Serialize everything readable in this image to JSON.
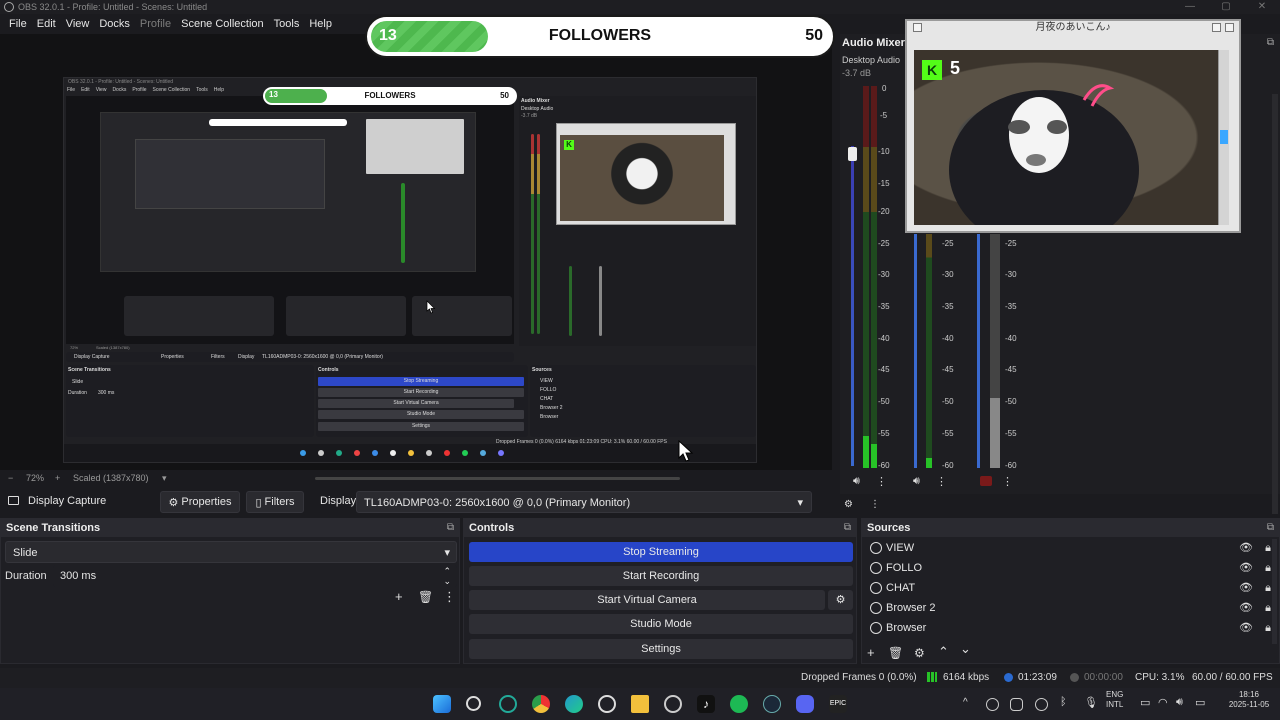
{
  "window": {
    "title": "OBS 32.0.1 - Profile: Untitled - Scenes: Untitled",
    "controls": [
      "—",
      "▢",
      "✕"
    ]
  },
  "menu": [
    "File",
    "Edit",
    "View",
    "Docks",
    "Profile",
    "Scene Collection",
    "Tools",
    "Help"
  ],
  "overlay": {
    "followers_current": "13",
    "followers_label": "FOLLOWERS",
    "followers_goal": "50",
    "followers_progress": 0.26,
    "cam_window_title": "月夜のあいこん♪",
    "kick_count": "5"
  },
  "nested": {
    "title": "OBS 32.0.1 - Profile: Untitled - Scenes: Untitled",
    "menu": [
      "File",
      "Edit",
      "View",
      "Docks",
      "Profile",
      "Scene Collection",
      "Tools",
      "Help"
    ],
    "followers_current": "13",
    "followers_label": "FOLLOWERS",
    "followers_goal": "50",
    "zoom": "72%",
    "scaled": "Scaled (1387x780)",
    "source_name": "Display Capture",
    "properties": "Properties",
    "filters": "Filters",
    "display_label": "Display",
    "display_value": "TL160ADMP03-0: 2560x1600 @ 0,0 (Primary Monitor)",
    "scene_transitions": "Scene Transitions",
    "transition": "Slide",
    "duration_label": "Duration",
    "duration_value": "300 ms",
    "controls": "Controls",
    "btn_stop": "Stop Streaming",
    "btn_rec": "Start Recording",
    "btn_vcam": "Start Virtual Camera",
    "btn_studio": "Studio Mode",
    "btn_settings": "Settings",
    "sources": "Sources",
    "source_list": [
      "VIEW",
      "FOLLO",
      "CHAT",
      "Browser 2",
      "Browser"
    ],
    "status": "Dropped Frames 0 (0.0%)   6164 kbps   01:23:09   CPU: 3.1%  60.00 / 60.00 FPS",
    "mixer_title": "Audio Mixer",
    "mixer_sub": "Desktop Audio",
    "mixer_db": "-3.7 dB"
  },
  "preview_bar": {
    "zoom_minus": "−",
    "zoom": "72%",
    "zoom_plus": "+",
    "scaled": "Scaled (1387x780)"
  },
  "source_toolbar": {
    "name": "Display Capture",
    "properties": "Properties",
    "filters": "Filters",
    "display_label": "Display",
    "display_value": "TL160ADMP03-0: 2560x1600 @ 0,0 (Primary Monitor)"
  },
  "mixer": {
    "title": "Audio Mixer",
    "channel": "Desktop Audio",
    "db": "-3.7 dB",
    "scale": [
      "0",
      "-5",
      "-10",
      "-15",
      "-20",
      "-25",
      "-30",
      "-35",
      "-40",
      "-45",
      "-50",
      "-55",
      "-60"
    ],
    "scale2": [
      "-25",
      "-30",
      "-35",
      "-40",
      "-45",
      "-50",
      "-55",
      "-60"
    ]
  },
  "scene_transitions": {
    "title": "Scene Transitions",
    "transition": "Slide",
    "duration_label": "Duration",
    "duration_value": "300 ms"
  },
  "controls": {
    "title": "Controls",
    "stop_streaming": "Stop Streaming",
    "start_recording": "Start Recording",
    "start_virtual_camera": "Start Virtual Camera",
    "studio_mode": "Studio Mode",
    "settings": "Settings"
  },
  "sources": {
    "title": "Sources",
    "items": [
      "VIEW",
      "FOLLO",
      "CHAT",
      "Browser 2",
      "Browser"
    ]
  },
  "status": {
    "dropped": "Dropped Frames 0 (0.0%)",
    "bitrate": "6164 kbps",
    "stream_time": "01:23:09",
    "rec_time": "00:00:00",
    "cpu": "CPU: 3.1%",
    "fps": "60.00 / 60.00 FPS"
  },
  "tray": {
    "lang1": "ENG",
    "lang2": "INTL",
    "time": "18:16",
    "date": "2025-11-05"
  },
  "colors": {
    "accent_blue": "#2745c8",
    "meter_green": "#27c227",
    "kick_green": "#53fc18"
  }
}
